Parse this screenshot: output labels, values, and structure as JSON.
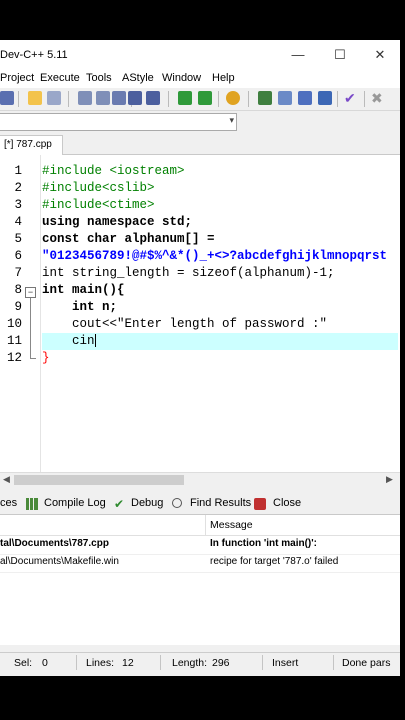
{
  "window": {
    "title": "Dev-C++ 5.11",
    "minimize": "—",
    "maximize": "☐",
    "close": "✕"
  },
  "menu": [
    "Project",
    "Execute",
    "Tools",
    "AStyle",
    "Window",
    "Help"
  ],
  "combo": {
    "value": "",
    "arrow": "▾"
  },
  "file_tab": "[*] 787.cpp",
  "editor": {
    "line_numbers": [
      "1",
      "2",
      "3",
      "4",
      "5",
      "6",
      "7",
      "8",
      "9",
      "10",
      "11",
      "12"
    ],
    "lines": [
      "#include <iostream>",
      "#include<cslib>",
      "#include<ctime>",
      "using namespace std;",
      "const char alphanum[] =",
      "\"0123456789!@#$%^&*()_+<>?abcdefghijklmnopqrst",
      "int string_length = sizeof(alphanum)-1;",
      "int main(){",
      "    int n;",
      "    cout<<\"Enter length of password :\"",
      "    cin",
      "}"
    ]
  },
  "bottom_tabs": {
    "resources": "ces",
    "compile_log": "Compile Log",
    "debug": "Debug",
    "find_results": "Find Results",
    "close": "Close"
  },
  "messages": {
    "header": "Message",
    "rows": [
      {
        "file": "tal\\Documents\\787.cpp",
        "message": "In function 'int main()':"
      },
      {
        "file": "al\\Documents\\Makefile.win",
        "message": "recipe for target '787.o' failed"
      }
    ]
  },
  "status": {
    "sel_label": "Sel:",
    "sel_value": "0",
    "lines_label": "Lines:",
    "lines_value": "12",
    "length_label": "Length:",
    "length_value": "296",
    "mode": "Insert",
    "parse": "Done pars"
  },
  "colors": {
    "keyword": "#000000",
    "preprocessor": "#008000",
    "string": "#0000ff",
    "operator": "#ff0000",
    "current_line": "#ccffff"
  }
}
